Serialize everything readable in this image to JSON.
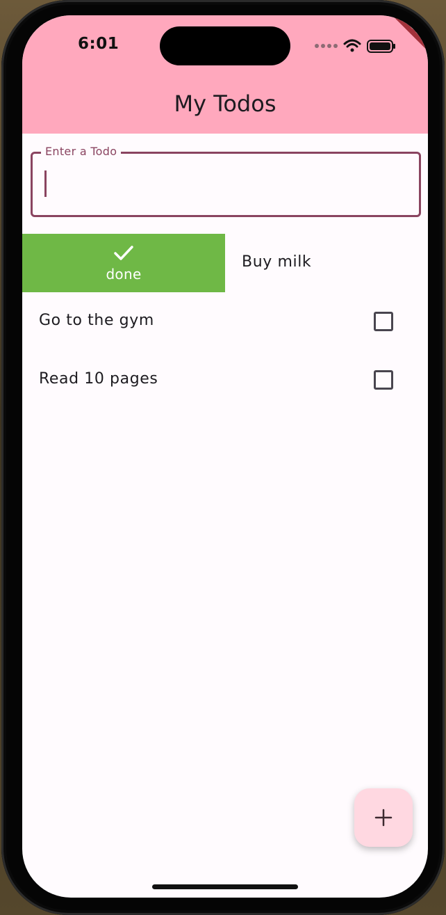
{
  "status_bar": {
    "time": "6:01",
    "icons": [
      "signal-dots-icon",
      "wifi-icon",
      "battery-icon"
    ]
  },
  "debug_banner": "DEBUG",
  "app_bar": {
    "title": "My Todos",
    "background_color": "#ffa8bd"
  },
  "todo_input": {
    "label": "Enter a Todo",
    "value": "",
    "accent_color": "#8a4460"
  },
  "todos": [
    {
      "title": "Buy milk",
      "checked": false,
      "swipe_action": {
        "icon": "check-icon",
        "label": "done",
        "color": "#6fb846"
      }
    },
    {
      "title": "Go to the gym",
      "checked": false
    },
    {
      "title": "Read 10 pages",
      "checked": false
    }
  ],
  "fab": {
    "icon": "plus-icon",
    "color": "#ffd8e1"
  }
}
